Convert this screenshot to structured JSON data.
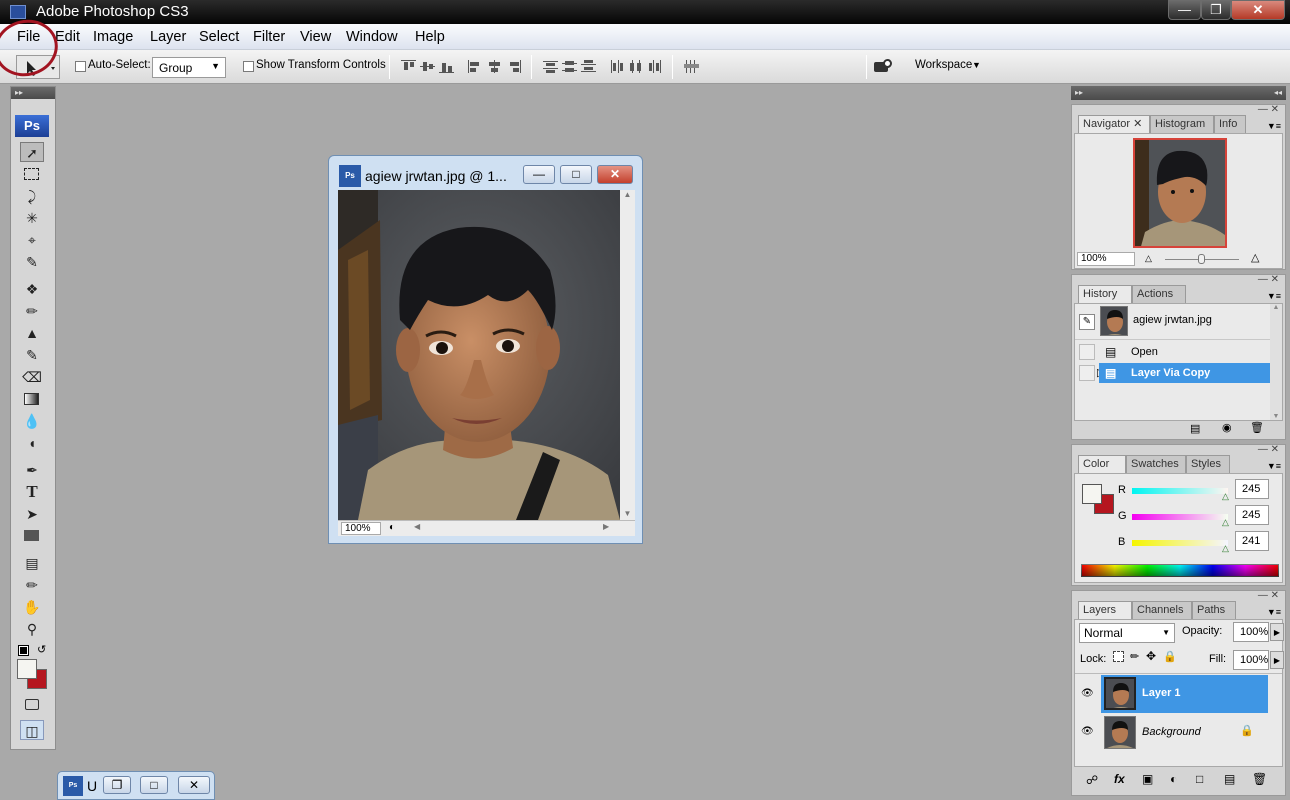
{
  "app": {
    "title": "Adobe Photoshop CS3"
  },
  "menu": [
    "File",
    "Edit",
    "Image",
    "Layer",
    "Select",
    "Filter",
    "View",
    "Window",
    "Help"
  ],
  "options": {
    "auto_select_label": "Auto-Select:",
    "auto_select_value": "Group",
    "show_transform_label": "Show Transform Controls",
    "workspace_label": "Workspace"
  },
  "tools": {
    "logo": "Ps"
  },
  "document": {
    "title": "agiew jrwtan.jpg @ 1...",
    "zoom": "100%"
  },
  "navigator": {
    "tabs": [
      "Navigator",
      "Histogram",
      "Info"
    ],
    "zoom": "100%"
  },
  "history": {
    "tabs": [
      "History",
      "Actions"
    ],
    "snapshot": "agiew jrwtan.jpg",
    "items": [
      {
        "label": "Open",
        "selected": false
      },
      {
        "label": "Layer Via Copy",
        "selected": true
      }
    ]
  },
  "color": {
    "tabs": [
      "Color",
      "Swatches",
      "Styles"
    ],
    "channels": [
      {
        "label": "R",
        "value": "245"
      },
      {
        "label": "G",
        "value": "245"
      },
      {
        "label": "B",
        "value": "241"
      }
    ],
    "fg": "#f5f5f1",
    "bg": "#b5161f"
  },
  "layers": {
    "tabs": [
      "Layers",
      "Channels",
      "Paths"
    ],
    "blend_mode": "Normal",
    "opacity_label": "Opacity:",
    "opacity": "100%",
    "lock_label": "Lock:",
    "fill_label": "Fill:",
    "fill": "100%",
    "items": [
      {
        "name": "Layer 1",
        "selected": true
      },
      {
        "name": "Background",
        "selected": false
      }
    ]
  },
  "taskbar": {
    "label": "U"
  }
}
